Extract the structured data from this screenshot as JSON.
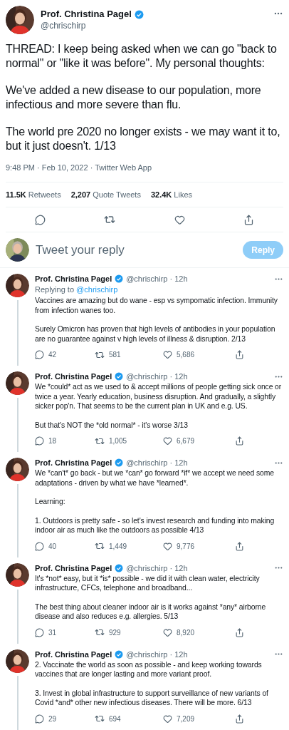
{
  "tweet": {
    "name": "Prof. Christina Pagel",
    "verified": true,
    "handle": "@chrischirp",
    "paragraphs": [
      "THREAD: I keep being asked when we can go \"back to normal\" or \"like it was before\". My personal thoughts:",
      "We've added a new disease to our population, more infectious and more severe than flu.",
      "The world pre 2020 no longer exists - we may want it to, but it just doesn't. 1/13"
    ],
    "meta": "9:48 PM · Feb 10, 2022 · Twitter Web App",
    "stats": [
      "**11.5K** Retweets",
      "**2,207** Quote Tweets",
      "**32.4K** Likes"
    ]
  },
  "composer": {
    "placeholder": "Tweet your reply",
    "button": "Reply",
    "disabled": true
  },
  "replies": [
    {
      "name": "Prof. Christina Pagel",
      "verified": true,
      "byline": "@chrischirp · 12h",
      "replying_label": "Replying to",
      "replying_handle": "@chrischirp",
      "paragraphs": [
        "Vaccines are amazing but do wane - esp vs sympomatic infection. Immunity from infection wanes too.",
        "Surely Omicron has proven that high levels of antibodies in your population are no guarantee against v high levels of illness & disruption. 2/13"
      ],
      "replies": "42",
      "retweets": "581",
      "likes": "5,686"
    },
    {
      "name": "Prof. Christina Pagel",
      "verified": true,
      "byline": "@chrischirp · 12h",
      "paragraphs": [
        "We *could* act as we used to & accept millions of people getting sick once or twice a year. Yearly education, business disruption. And gradually, a slightly sicker pop'n. That seems to be the current plan in UK and e.g. US.",
        "But that's NOT the *old normal* - it's worse 3/13"
      ],
      "replies": "18",
      "retweets": "1,005",
      "likes": "6,679"
    },
    {
      "name": "Prof. Christina Pagel",
      "verified": true,
      "byline": "@chrischirp · 12h",
      "paragraphs": [
        "We *can't* go back - but we *can* go forward *if* we accept we need some adaptations - driven by what we have *learned*.",
        "Learning:",
        "1. Outdoors is pretty safe - so let's invest research and funding into making indoor air as much like the outdoors as possible 4/13"
      ],
      "replies": "40",
      "retweets": "1,449",
      "likes": "9,776"
    },
    {
      "name": "Prof. Christina Pagel",
      "verified": true,
      "byline": "@chrischirp · 12h",
      "paragraphs": [
        "It's *not* easy, but it *is* possible - we did it with clean water, electricity infrastructure, CFCs, telephone and broadband...",
        "The best thing about cleaner indoor air is it works against *any* airborne disease and also reduces e.g. allergies. 5/13"
      ],
      "replies": "31",
      "retweets": "929",
      "likes": "8,920"
    },
    {
      "name": "Prof. Christina Pagel",
      "verified": true,
      "byline": "@chrischirp · 12h",
      "paragraphs": [
        "2. Vaccinate the world as soon as possible  - and keep working towards vaccines that are longer lasting and more variant proof.",
        "3. Invest in global infrastructure to support surveillance of new variants of Covid *and* other new infectious diseases. There will be more. 6/13"
      ],
      "replies": "29",
      "retweets": "694",
      "likes": "7,209"
    }
  ]
}
